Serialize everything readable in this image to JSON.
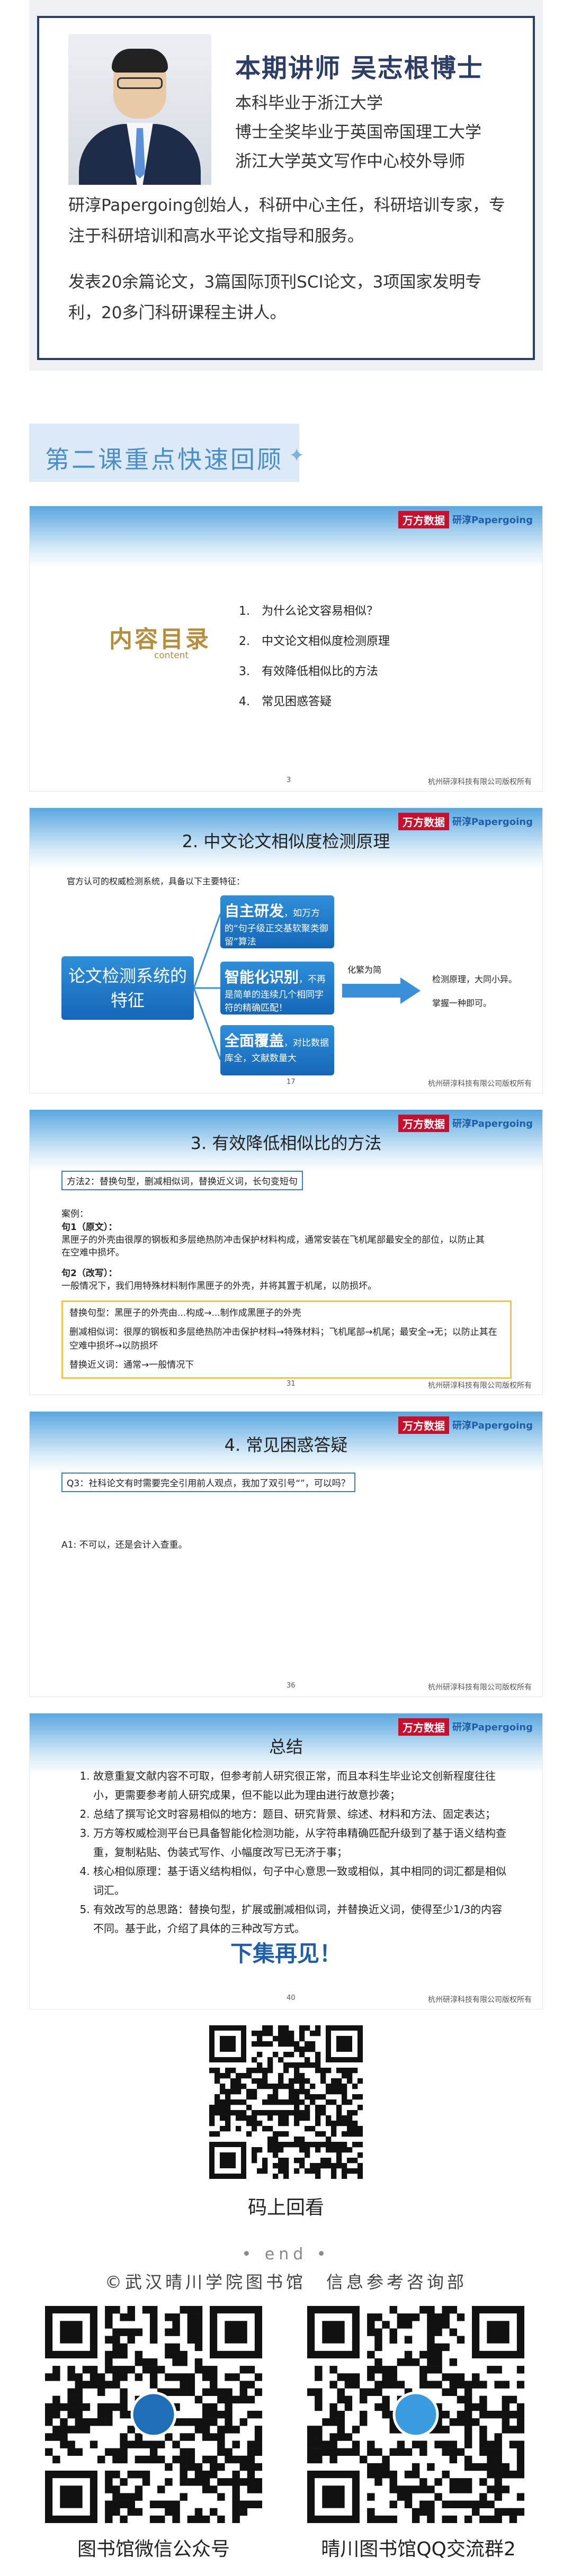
{
  "teacher": {
    "title": "本期讲师 吴志根博士",
    "lines": [
      "本科毕业于浙江大学",
      "博士全奖毕业于英国帝国理工大学",
      "浙江大学英文写作中心校外导师"
    ],
    "bio1": "研淳Papergoing创始人，科研中心主任，科研培训专家，专注于科研培训和高水平论文指导和服务。",
    "bio2": "发表20余篇论文，3篇国际顶刊SCI论文，3项国家发明专利，20多门科研课程主讲人。"
  },
  "review_heading": "第二课重点快速回顾",
  "brand": {
    "wanfang": "万方数据",
    "papergoing": "研淳Papergoing"
  },
  "slide_footer": "杭州研淳科技有限公司版权所有",
  "toc": {
    "title": "内容目录",
    "subtitle": "content",
    "items": [
      "1.　为什么论文容易相似？",
      "2.　中文论文相似度检测原理",
      "3.　有效降低相似比的方法",
      "4.　常见困惑答疑"
    ],
    "page": "3"
  },
  "principle": {
    "title": "2. 中文论文相似度检测原理",
    "intro": "官方认可的权威检测系统，具备以下主要特征：",
    "main": "论文检测系统的特征",
    "features": [
      {
        "head": "自主研发",
        "body": "，如万方的“句子级正交基软聚类御留”算法"
      },
      {
        "head": "智能化识别",
        "body": "，不再是简单的连续几个相同字符的精确匹配！"
      },
      {
        "head": "全面覆盖",
        "body": "，对比数据库全，文献数量大"
      }
    ],
    "arrow_label": "化繁为简",
    "result_line1": "检测原理，大同小异。",
    "result_line2": "掌握一种即可。",
    "page": "17"
  },
  "methods": {
    "title": "3. 有效降低相似比的方法",
    "method": "方法2：替换句型，删减相似词，替换近义词，长句变短句",
    "case_label": "案例：",
    "orig_label": "句1（原文）：",
    "orig_text": "黑匣子的外壳由很厚的钢板和多层绝热防冲击保护材料构成，通常安装在飞机尾部最安全的部位，以防止其在空难中损坏。",
    "rewrite_label": "句2（改写）：",
    "rewrite_text": "一般情况下，我们用特殊材料制作黑匣子的外壳，并将其置于机尾，以防损坏。",
    "box_lines": [
      "替换句型：黑匣子的外壳由...构成→...制作成黑匣子的外壳",
      "删减相似词：很厚的钢板和多层绝热防冲击保护材料→特殊材料；飞机尾部→机尾；最安全→无；以防止其在空难中损坏→以防损坏",
      "替换近义词：通常→一般情况下"
    ],
    "page": "31"
  },
  "faq": {
    "title": "4. 常见困惑答疑",
    "question": "Q3：社科论文有时需要完全引用前人观点，我加了双引号“”，可以吗？",
    "answer": "A1: 不可以，还是会计入查重。",
    "page": "36"
  },
  "summary": {
    "title": "总结",
    "items": [
      "故意重复文献内容不可取，但参考前人研究很正常，而且本科生毕业论文创新程度往往小，更需要参考前人研究成果，但不能以此为理由进行故意抄袭；",
      "总结了撰写论文时容易相似的地方：题目、研究背景、综述、材料和方法、固定表达；",
      "万方等权威检测平台已具备智能化检测功能，从字符串精确匹配升级到了基于语义结构查重，复制粘贴、伪装式写作、小幅度改写已无济于事；",
      "核心相似原理：基于语义结构相似，句子中心意思一致或相似，其中相同的词汇都是相似词汇。",
      "有效改写的总思路：替换句型，扩展或删减相似词，并替换近义词，使得至少1/3的内容不同。基于此，介绍了具体的三种改写方式。"
    ],
    "bye": "下集再见！",
    "page": "40"
  },
  "qr_main_label": "码上回看",
  "end": "• end •",
  "credit": "©武汉晴川学院图书馆　信息参考咨询部",
  "qr_left_label": "图书馆微信公众号",
  "qr_right_label": "晴川图书馆QQ交流群2"
}
